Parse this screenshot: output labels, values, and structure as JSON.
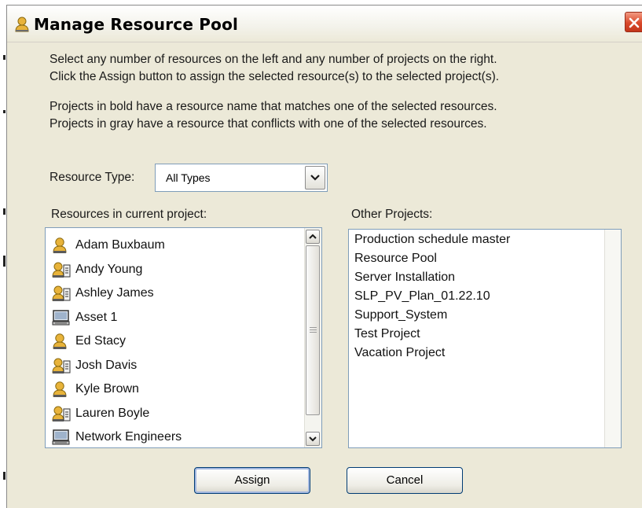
{
  "window": {
    "title": "Manage Resource Pool"
  },
  "instructions": [
    "Select any number of resources on the left and any number of projects on the right.",
    "Click the Assign button to assign the selected resource(s) to the selected project(s).",
    "Projects in bold have a resource name that matches one of the selected resources.",
    "Projects in gray have a resource that conflicts with one of the selected resources."
  ],
  "resource_type": {
    "label": "Resource Type:",
    "selected": "All Types"
  },
  "resources": {
    "label": "Resources in current project:",
    "items": [
      {
        "name": "Adam Buxbaum",
        "icon": "person-icon"
      },
      {
        "name": "Andy Young",
        "icon": "person-card-icon"
      },
      {
        "name": "Ashley James",
        "icon": "person-card-icon"
      },
      {
        "name": "Asset 1",
        "icon": "computer-icon"
      },
      {
        "name": "Ed Stacy",
        "icon": "person-icon"
      },
      {
        "name": "Josh Davis",
        "icon": "person-card-icon"
      },
      {
        "name": "Kyle Brown",
        "icon": "person-icon"
      },
      {
        "name": "Lauren Boyle",
        "icon": "person-card-icon"
      },
      {
        "name": "Network Engineers",
        "icon": "computer-icon"
      }
    ]
  },
  "projects": {
    "label": "Other Projects:",
    "items": [
      "Production schedule master",
      "Resource Pool",
      "Server Installation",
      "SLP_PV_Plan_01.22.10",
      "Support_System",
      "Test Project",
      "Vacation Project"
    ]
  },
  "buttons": {
    "assign": "Assign",
    "cancel": "Cancel"
  }
}
